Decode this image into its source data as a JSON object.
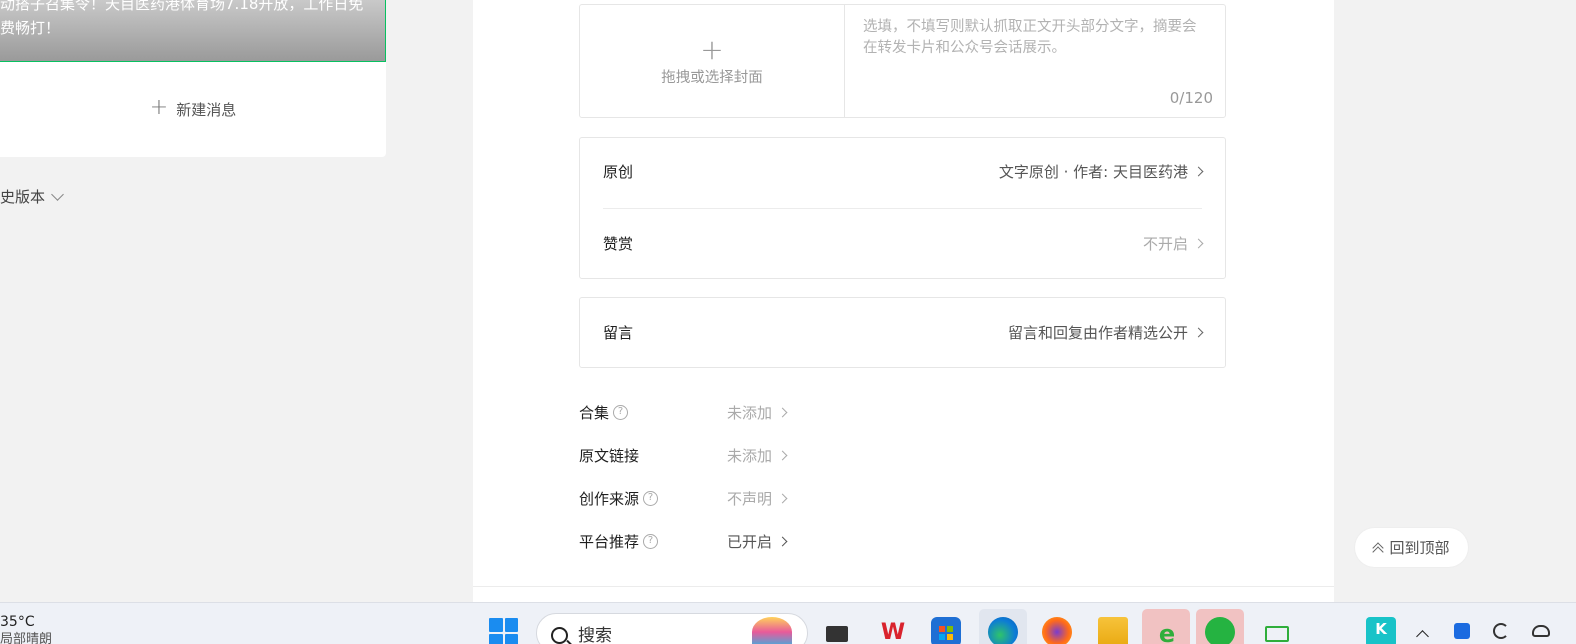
{
  "left_panel": {
    "article_title": "动搭子召集令！天目医药港体育场7.18开放，工作日免费畅打！",
    "new_message_label": "新建消息",
    "history_label": "史版本"
  },
  "editor": {
    "cover_upload_label": "拖拽或选择封面",
    "summary_placeholder": "选填，不填写则默认抓取正文开头部分文字，摘要会在转发卡片和公众号会话展示。",
    "summary_count": "0/120",
    "original_label": "原创",
    "original_value": "文字原创 · 作者: 天目医药港",
    "reward_label": "赞赏",
    "reward_value": "不开启",
    "comment_label": "留言",
    "comment_value": "留言和回复由作者精选公开",
    "options": [
      {
        "label": "合集",
        "value": "未添加"
      },
      {
        "label": "原文链接",
        "value": "未添加"
      },
      {
        "label": "创作来源",
        "value": "不声明"
      },
      {
        "label": "平台推荐",
        "value": "已开启"
      }
    ],
    "back_to_top_label": "回到顶部"
  },
  "taskbar": {
    "weather_temp": "35°C",
    "weather_desc": "局部晴朗",
    "search_label": "搜索",
    "apps": [
      "task-view",
      "wps",
      "microsoft-store",
      "edge",
      "firefox",
      "file-explorer",
      "ie-browser",
      "wechat",
      "wechat-work",
      "remote-desktop"
    ],
    "tray": [
      "kugou",
      "chevron-up",
      "tray-app",
      "sync",
      "network-offline"
    ]
  },
  "colors": {
    "accent_green": "#07c160",
    "page_bg": "#f2f2f2",
    "panel_bg": "#ffffff",
    "muted_text": "#aaaaaa"
  }
}
